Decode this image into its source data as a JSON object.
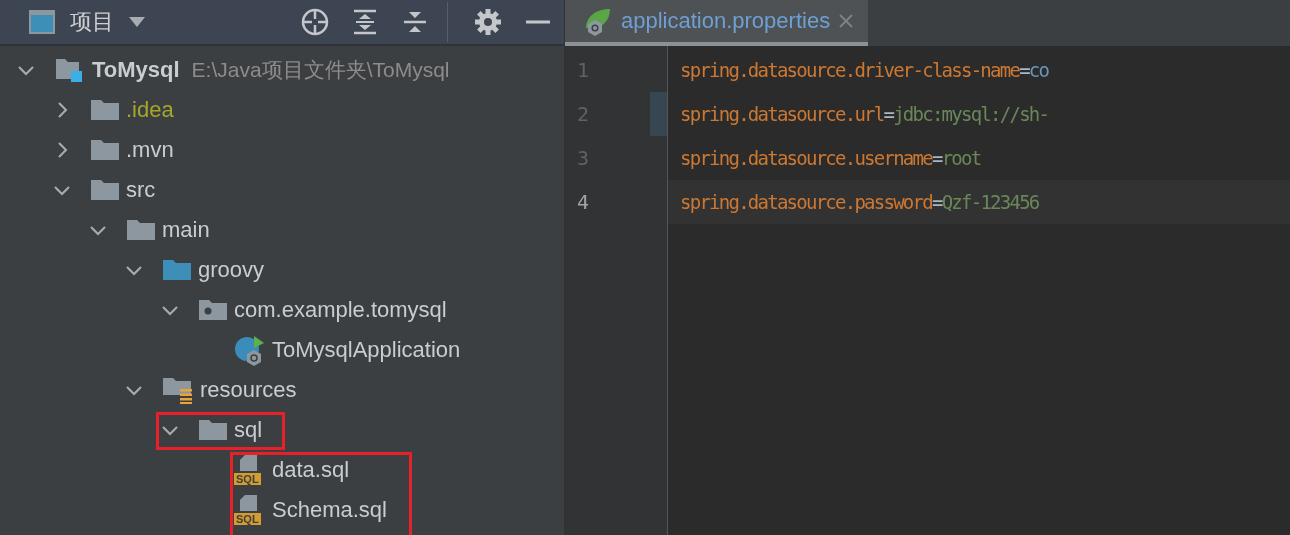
{
  "project_panel": {
    "title": "项目",
    "tree": [
      {
        "label": "ToMysql",
        "path": "E:\\Java项目文件夹\\ToMysql",
        "kind": "project",
        "expanded": true,
        "ignored": false,
        "highlighted": false,
        "children": [
          {
            "label": ".idea",
            "kind": "folder",
            "expanded": false,
            "ignored": true,
            "highlighted": false
          },
          {
            "label": ".mvn",
            "kind": "folder",
            "expanded": false,
            "ignored": false,
            "highlighted": false
          },
          {
            "label": "src",
            "kind": "folder",
            "expanded": true,
            "ignored": false,
            "highlighted": false,
            "children": [
              {
                "label": "main",
                "kind": "folder",
                "expanded": true,
                "ignored": false,
                "highlighted": false,
                "children": [
                  {
                    "label": "groovy",
                    "kind": "source-folder",
                    "expanded": true,
                    "ignored": false,
                    "highlighted": false,
                    "children": [
                      {
                        "label": "com.example.tomysql",
                        "kind": "package",
                        "expanded": true,
                        "ignored": false,
                        "highlighted": false,
                        "children": [
                          {
                            "label": "ToMysqlApplication",
                            "kind": "spring-class",
                            "ignored": false,
                            "highlighted": false
                          }
                        ]
                      }
                    ]
                  },
                  {
                    "label": "resources",
                    "kind": "resource-folder",
                    "expanded": true,
                    "ignored": false,
                    "highlighted": false,
                    "children": [
                      {
                        "label": "sql",
                        "kind": "folder",
                        "expanded": true,
                        "ignored": false,
                        "highlighted": true,
                        "children_highlighted": true,
                        "children": [
                          {
                            "label": "data.sql",
                            "kind": "sql-file",
                            "badge": "SQL",
                            "ignored": false,
                            "highlighted": false
                          },
                          {
                            "label": "Schema.sql",
                            "kind": "sql-file",
                            "badge": "SQL",
                            "ignored": false,
                            "highlighted": false
                          }
                        ]
                      }
                    ]
                  }
                ]
              }
            ]
          }
        ]
      }
    ]
  },
  "editor": {
    "tabs": [
      {
        "label": "application.properties",
        "selected": true
      }
    ],
    "lines": [
      {
        "number": "1",
        "key": "spring.datasource.driver-class-name",
        "separator": "=",
        "value": "co",
        "class_value": true,
        "current": false,
        "changed": false
      },
      {
        "number": "2",
        "key": "spring.datasource.url",
        "separator": "=",
        "value": "jdbc:mysql://sh-",
        "class_value": false,
        "current": false,
        "changed": true
      },
      {
        "number": "3",
        "key": "spring.datasource.username",
        "separator": "=",
        "value": "root",
        "class_value": false,
        "current": false,
        "changed": false
      },
      {
        "number": "4",
        "key": "spring.datasource.password",
        "separator": "=",
        "value": "Qzf-123456",
        "class_value": false,
        "current": true,
        "changed": false
      }
    ]
  }
}
